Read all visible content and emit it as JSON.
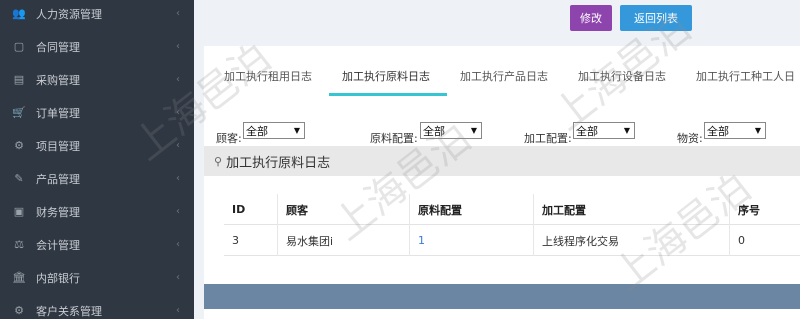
{
  "sidebar": {
    "items": [
      {
        "label": "人力资源管理",
        "icon": "people-icon",
        "glyph": "👥"
      },
      {
        "label": "合同管理",
        "icon": "document-icon",
        "glyph": "▢"
      },
      {
        "label": "采购管理",
        "icon": "box-icon",
        "glyph": "▤"
      },
      {
        "label": "订单管理",
        "icon": "cart-icon",
        "glyph": "🛒"
      },
      {
        "label": "项目管理",
        "icon": "cog-icon",
        "glyph": "⚙"
      },
      {
        "label": "产品管理",
        "icon": "edit-icon",
        "glyph": "✎"
      },
      {
        "label": "财务管理",
        "icon": "money-icon",
        "glyph": "▣"
      },
      {
        "label": "会计管理",
        "icon": "scale-icon",
        "glyph": "⚖"
      },
      {
        "label": "内部银行",
        "icon": "bank-icon",
        "glyph": "🏛"
      },
      {
        "label": "客户关系管理",
        "icon": "gears-icon",
        "glyph": "⚙"
      }
    ],
    "chevron": "‹"
  },
  "toolbar": {
    "edit_label": "修改",
    "back_label": "返回列表"
  },
  "tabs": [
    {
      "label": "加工执行租用日志",
      "active": false
    },
    {
      "label": "加工执行原料日志",
      "active": true
    },
    {
      "label": "加工执行产品日志",
      "active": false
    },
    {
      "label": "加工执行设备日志",
      "active": false
    },
    {
      "label": "加工执行工种工人日",
      "active": false
    }
  ],
  "filters": [
    {
      "label": "顾客:",
      "value": "全部"
    },
    {
      "label": "原料配置:",
      "value": "全部"
    },
    {
      "label": "加工配置:",
      "value": "全部"
    },
    {
      "label": "物资:",
      "value": "全部"
    }
  ],
  "section": {
    "title": "加工执行原料日志",
    "icon": "user-icon"
  },
  "table": {
    "columns": [
      "ID",
      "顾客",
      "原料配置",
      "加工配置",
      "序号"
    ],
    "rows": [
      [
        "3",
        "易水集团i",
        "1",
        "上线程序化交易",
        "0"
      ]
    ]
  },
  "watermark": "上海邑泊",
  "colors": {
    "sidebar_bg": "#2f3742",
    "edit_button": "#8e44ad",
    "back_button": "#3498db",
    "tab_active_underline": "#36c6d3",
    "footer_bar": "#6b86a3",
    "link": "#3a7bd5"
  }
}
